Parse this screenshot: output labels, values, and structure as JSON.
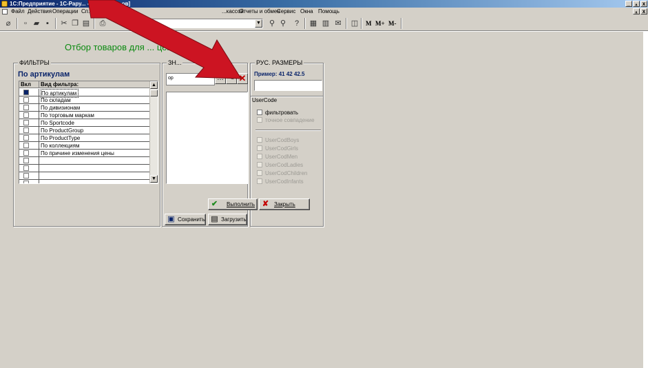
{
  "window": {
    "title": "1С:Предприятие - 1С-Рару... - [Отбор то...ов]",
    "minimize_icon": "_",
    "restore_icon": "ₐ",
    "close_icon": "x"
  },
  "menubar": {
    "items": [
      "Файл",
      "Действия",
      "Операции",
      "Сп...",
      "...кассой",
      "Отчеты и обмен",
      "Сервис",
      "Окна",
      "Помощь"
    ]
  },
  "toolbar": {
    "m_labels": [
      "M",
      "M+",
      "M-"
    ]
  },
  "form": {
    "title": "Отбор товаров для ... ценников"
  },
  "filters": {
    "legend": "ФИЛЬТРЫ",
    "current": "По артикулам",
    "columns": [
      "Вкл",
      "Вид фильтра:"
    ],
    "rows": [
      {
        "label": "По артикулам",
        "selected": true
      },
      {
        "label": "По складам",
        "selected": false
      },
      {
        "label": "По дивизионам",
        "selected": false
      },
      {
        "label": "По торговым маркам",
        "selected": false
      },
      {
        "label": "По Sportcode",
        "selected": false
      },
      {
        "label": "По ProductGroup",
        "selected": false
      },
      {
        "label": "По ProductType",
        "selected": false
      },
      {
        "label": "По коллекциям",
        "selected": false
      },
      {
        "label": "По причине изменения цены",
        "selected": false
      },
      {
        "label": "",
        "selected": false
      },
      {
        "label": "",
        "selected": false
      },
      {
        "label": "",
        "selected": false
      },
      {
        "label": "",
        "selected": false
      }
    ]
  },
  "values": {
    "legend": "ЗН...",
    "edit_value": "ор",
    "save_label": "Сохранить",
    "load_label": "Загрузить"
  },
  "sizes": {
    "legend": "РУС. РАЗМЕРЫ",
    "example": "Пример: 41 42 42.5",
    "input_value": "",
    "usercode_legend": "UserCode",
    "filter_label": "фильтровать",
    "exact_label": "точное совпадение",
    "usercodes": [
      "UserCodBoys",
      "UserCodGirls",
      "UserCodMen",
      "UserCodLadies",
      "UserCodChildren",
      "UserCodInfants"
    ]
  },
  "actions": {
    "run_label": "Выполнить",
    "close_label": "Закрыть"
  },
  "colors": {
    "form_title": "#0b8a10",
    "heading": "#0a246a",
    "arrow": "#cc1422"
  }
}
